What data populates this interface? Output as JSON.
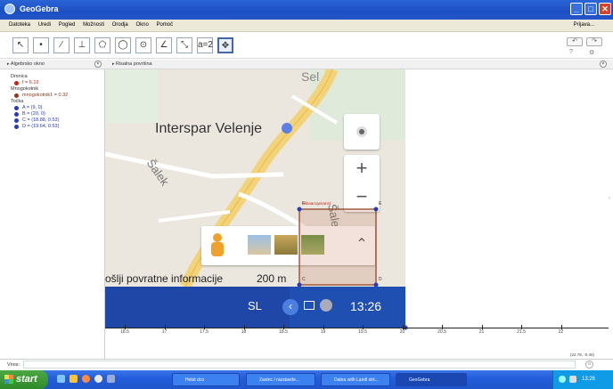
{
  "window": {
    "title": "GeoGebra"
  },
  "menu": {
    "items": [
      "Datoteka",
      "Uredi",
      "Pogled",
      "Možnosti",
      "Orodja",
      "Okno",
      "Pomoč"
    ],
    "right": "Prijava..."
  },
  "algebra": {
    "header": "Algebrsko okno",
    "categories": [
      {
        "name": "Drsnica",
        "objects": [
          "f = 6.16"
        ]
      },
      {
        "name": "Mnogokotnik",
        "objects": [
          "mnogokotnik1 = 0.32"
        ]
      },
      {
        "name": "Točka",
        "objects": [
          "A = (9, 0)",
          "B = (20, 0)",
          "C = (18.88, 0.53)",
          "D = (19.64, 0.53)"
        ]
      }
    ]
  },
  "graphics": {
    "header": "Risalna površina",
    "x_ticks": [
      "18.5",
      "17",
      "17.5",
      "18",
      "18.5",
      "19",
      "19.5",
      "20",
      "20.5",
      "21",
      "21.5",
      "22"
    ],
    "coord_readout": "(22.78, -0.40)"
  },
  "map": {
    "place_label": "Interspar Velenje",
    "street_label": "Šalek",
    "street_label2": "Šale",
    "top_label": "Sel",
    "feedback_text": "ošlji povratne informacije",
    "scale_text": "200 m",
    "bar_lang": "SL",
    "bar_time": "13:26",
    "image_label": "Slikaarcqeiranst",
    "point_labels": [
      "F",
      "E",
      "C",
      "D"
    ]
  },
  "input": {
    "label": "Vnos:"
  },
  "taskbar": {
    "start": "start",
    "tasks": [
      "Hetst dco",
      "Zastnc / razstavde...",
      "Datoa with Landi strt...",
      "GeoGebra"
    ],
    "clock": "13:26"
  },
  "colors": {
    "point_blue": "#2a3bb8",
    "slider_red": "#c0281b",
    "polygon_red": "#8b3a1a",
    "map_bar_blue": "#1e47a8"
  }
}
